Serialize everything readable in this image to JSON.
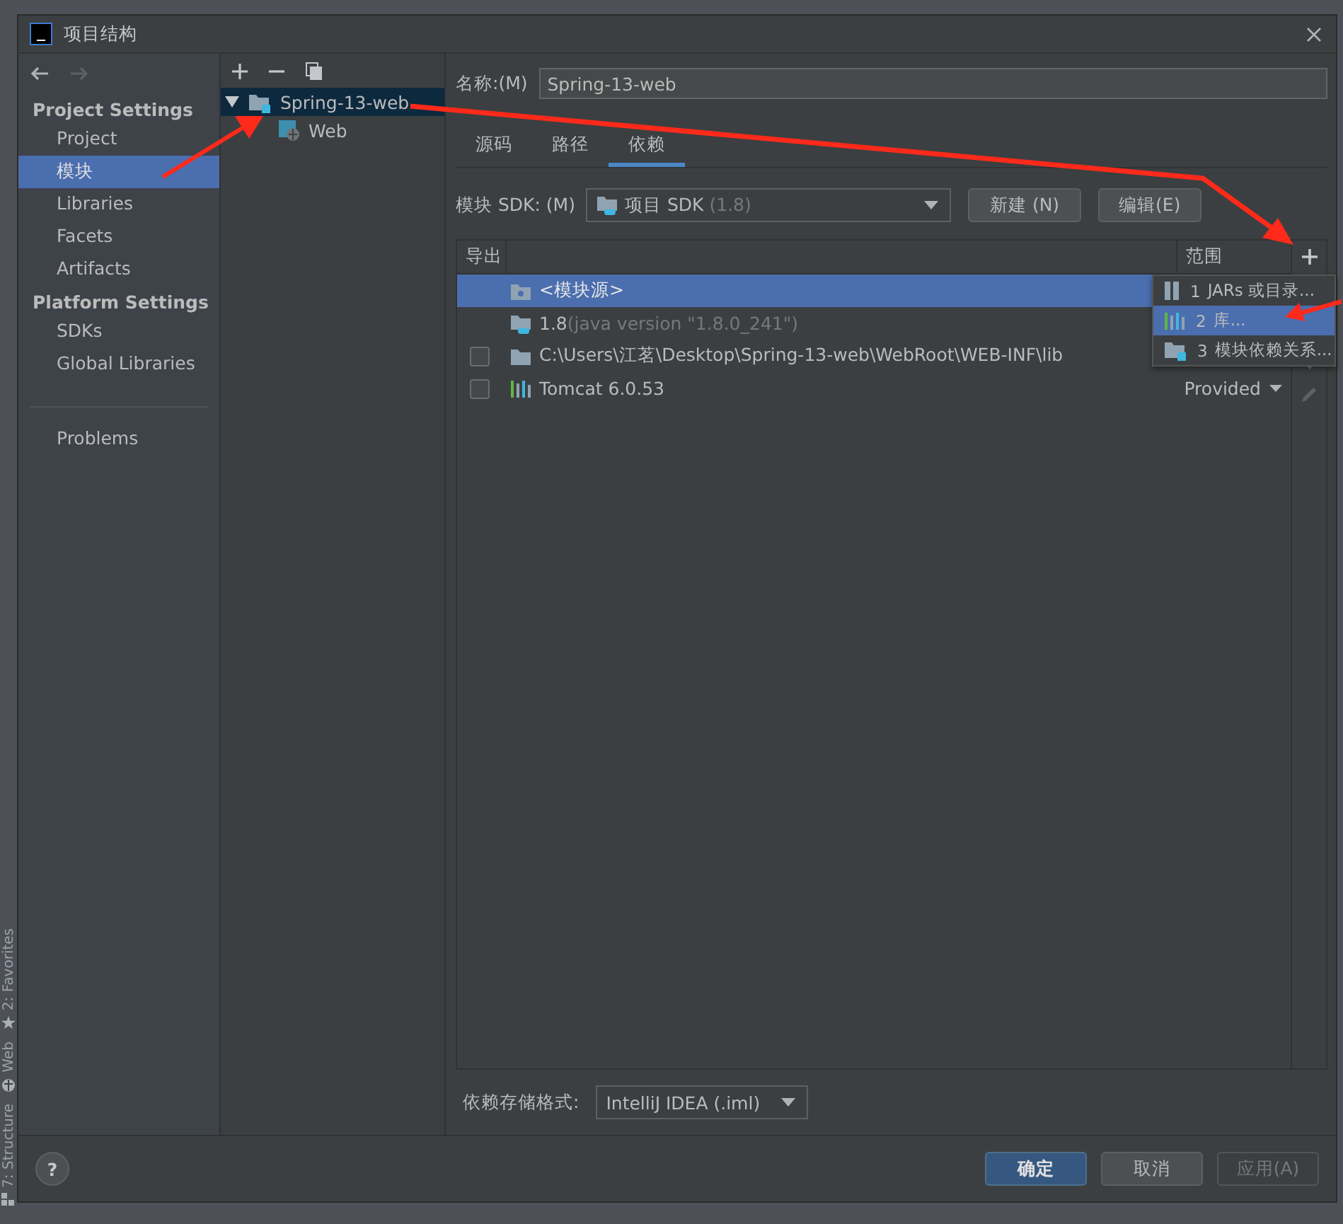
{
  "window": {
    "title": "项目结构"
  },
  "side_strip": [
    {
      "label": "2: Favorites",
      "kind": "star"
    },
    {
      "label": "Web",
      "kind": "web"
    },
    {
      "label": "7: Structure",
      "kind": "structure"
    }
  ],
  "sidebar": {
    "sections": [
      {
        "heading": "Project Settings",
        "items": [
          {
            "label": "Project",
            "selected": false
          },
          {
            "label": "模块",
            "selected": true
          },
          {
            "label": "Libraries",
            "selected": false
          },
          {
            "label": "Facets",
            "selected": false
          },
          {
            "label": "Artifacts",
            "selected": false
          }
        ]
      },
      {
        "heading": "Platform Settings",
        "items": [
          {
            "label": "SDKs",
            "selected": false
          },
          {
            "label": "Global Libraries",
            "selected": false
          }
        ]
      }
    ],
    "bottom_items": [
      {
        "label": "Problems",
        "selected": false
      }
    ]
  },
  "tree": {
    "items": [
      {
        "label": "Spring-13-web",
        "kind": "module",
        "expanded": true,
        "selected": true,
        "children": [
          {
            "label": "Web",
            "kind": "web",
            "selected": false
          }
        ]
      }
    ]
  },
  "module": {
    "name_label": "名称:(M)",
    "name_value": "Spring-13-web",
    "tabs": [
      {
        "label": "源码",
        "selected": false
      },
      {
        "label": "路径",
        "selected": false
      },
      {
        "label": "依赖",
        "selected": true
      }
    ],
    "sdk_label": "模块 SDK:  (M)",
    "sdk_value": "项目 SDK",
    "sdk_version": "(1.8)",
    "sdk_buttons": [
      "新建 (N)",
      "编辑(E)"
    ]
  },
  "table": {
    "columns": [
      "导出",
      "范围"
    ],
    "rows": [
      {
        "kind": "source",
        "name": "<模块源>",
        "selected": true
      },
      {
        "kind": "sdk",
        "name": "1.8",
        "detail": "(java version \"1.8.0_241\")",
        "selected": false
      },
      {
        "kind": "folder",
        "name": "C:\\Users\\江茗\\Desktop\\Spring-13-web\\WebRoot\\WEB-INF\\lib",
        "checked": false,
        "selected": false
      },
      {
        "kind": "library",
        "name": "Tomcat 6.0.53",
        "checked": false,
        "scope": "Provided",
        "selected": false
      }
    ]
  },
  "add_menu": [
    {
      "number": "1",
      "label": "JARs 或目录...",
      "kind": "jar",
      "selected": false
    },
    {
      "number": "2",
      "label": "库...",
      "kind": "library",
      "selected": true
    },
    {
      "number": "3",
      "label": "模块依赖关系...",
      "kind": "module",
      "selected": false
    }
  ],
  "format": {
    "label": "依赖存储格式:",
    "value": "IntelliJ IDEA (.iml)"
  },
  "help": "?",
  "footer_buttons": [
    {
      "label": "确定",
      "kind": "primary",
      "disabled": false
    },
    {
      "label": "取消",
      "kind": "normal",
      "disabled": false
    },
    {
      "label": "应用(A)",
      "kind": "normal",
      "disabled": true
    }
  ]
}
